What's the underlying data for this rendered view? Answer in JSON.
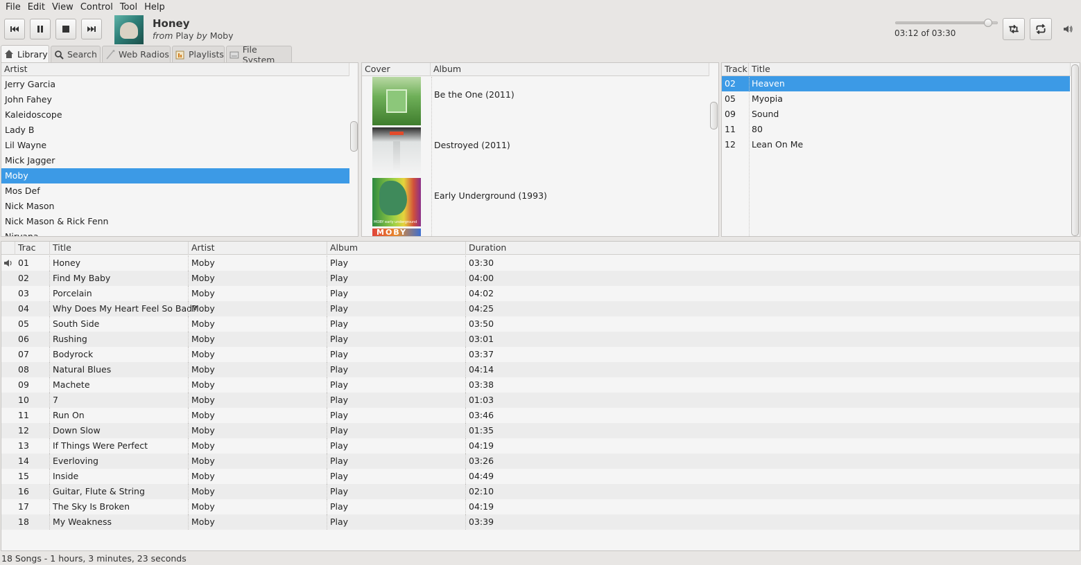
{
  "menu": [
    "File",
    "Edit",
    "View",
    "Control",
    "Tool",
    "Help"
  ],
  "now_playing": {
    "title": "Honey",
    "from_word": "from",
    "album": "Play",
    "by_word": "by",
    "artist": "Moby",
    "time": "03:12 of 03:30",
    "progress": 0.914
  },
  "icons": {
    "prev": "skip-back-icon",
    "pause": "pause-icon",
    "stop": "stop-icon",
    "next": "skip-forward-icon",
    "shuffle": "shuffle-icon",
    "repeat": "repeat-icon",
    "volume": "volume-icon"
  },
  "tabs": [
    {
      "label": "Library",
      "icon": "home-icon"
    },
    {
      "label": "Search",
      "icon": "search-icon"
    },
    {
      "label": "Web Radios",
      "icon": "antenna-icon"
    },
    {
      "label": "Playlists",
      "icon": "playlist-icon"
    },
    {
      "label": "File System",
      "icon": "drive-icon"
    }
  ],
  "artists_panel": {
    "header": "Artist",
    "items": [
      "Jerry Garcia",
      "John Fahey",
      "Kaleidoscope",
      "Lady B",
      "Lil Wayne",
      "Mick Jagger",
      "Moby",
      "Mos Def",
      "Nick Mason",
      "Nick Mason & Rick Fenn",
      "Nirvana"
    ],
    "selected": "Moby"
  },
  "albums_panel": {
    "header_cover": "Cover",
    "header_album": "Album",
    "items": [
      "Be the One (2011)",
      "Destroyed (2011)",
      "Early Underground (1993)"
    ],
    "cover_text": [
      "",
      "",
      "MOBY early underground",
      "MOBY"
    ]
  },
  "tracks_panel": {
    "header_track": "Track",
    "header_title": "Title",
    "items": [
      {
        "track": "02",
        "title": "Heaven"
      },
      {
        "track": "05",
        "title": "Myopia"
      },
      {
        "track": "09",
        "title": "Sound"
      },
      {
        "track": "11",
        "title": "80"
      },
      {
        "track": "12",
        "title": "Lean On Me"
      }
    ],
    "selected_index": 0
  },
  "playlist": {
    "headers": {
      "track": "Trac",
      "title": "Title",
      "artist": "Artist",
      "album": "Album",
      "duration": "Duration"
    },
    "rows": [
      {
        "track": "01",
        "title": "Honey",
        "artist": "Moby",
        "album": "Play",
        "duration": "03:30"
      },
      {
        "track": "02",
        "title": "Find My Baby",
        "artist": "Moby",
        "album": "Play",
        "duration": "04:00"
      },
      {
        "track": "03",
        "title": "Porcelain",
        "artist": "Moby",
        "album": "Play",
        "duration": "04:02"
      },
      {
        "track": "04",
        "title": "Why Does My Heart Feel So Bad?",
        "artist": "Moby",
        "album": "Play",
        "duration": "04:25"
      },
      {
        "track": "05",
        "title": "South Side",
        "artist": "Moby",
        "album": "Play",
        "duration": "03:50"
      },
      {
        "track": "06",
        "title": "Rushing",
        "artist": "Moby",
        "album": "Play",
        "duration": "03:01"
      },
      {
        "track": "07",
        "title": "Bodyrock",
        "artist": "Moby",
        "album": "Play",
        "duration": "03:37"
      },
      {
        "track": "08",
        "title": "Natural Blues",
        "artist": "Moby",
        "album": "Play",
        "duration": "04:14"
      },
      {
        "track": "09",
        "title": "Machete",
        "artist": "Moby",
        "album": "Play",
        "duration": "03:38"
      },
      {
        "track": "10",
        "title": "7",
        "artist": "Moby",
        "album": "Play",
        "duration": "01:03"
      },
      {
        "track": "11",
        "title": "Run On",
        "artist": "Moby",
        "album": "Play",
        "duration": "03:46"
      },
      {
        "track": "12",
        "title": "Down Slow",
        "artist": "Moby",
        "album": "Play",
        "duration": "01:35"
      },
      {
        "track": "13",
        "title": "If Things Were Perfect",
        "artist": "Moby",
        "album": "Play",
        "duration": "04:19"
      },
      {
        "track": "14",
        "title": "Everloving",
        "artist": "Moby",
        "album": "Play",
        "duration": "03:26"
      },
      {
        "track": "15",
        "title": "Inside",
        "artist": "Moby",
        "album": "Play",
        "duration": "04:49"
      },
      {
        "track": "16",
        "title": "Guitar, Flute & String",
        "artist": "Moby",
        "album": "Play",
        "duration": "02:10"
      },
      {
        "track": "17",
        "title": "The Sky Is Broken",
        "artist": "Moby",
        "album": "Play",
        "duration": "04:19"
      },
      {
        "track": "18",
        "title": "My Weakness",
        "artist": "Moby",
        "album": "Play",
        "duration": "03:39"
      }
    ],
    "playing_index": 0
  },
  "status": "18 Songs - 1 hours, 3 minutes, 23 seconds",
  "colors": {
    "selection": "#3c9ae6"
  }
}
